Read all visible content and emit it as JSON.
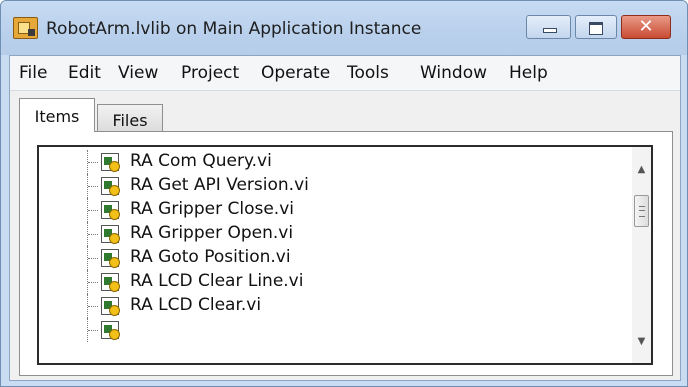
{
  "window": {
    "title": "RobotArm.lvlib on Main Application Instance",
    "icon": "labview-project-icon",
    "controls": {
      "minimize": "minimize-icon",
      "maximize": "maximize-icon",
      "close": "close-icon"
    }
  },
  "menubar": {
    "items": [
      "File",
      "Edit",
      "View",
      "Project",
      "Operate",
      "Tools",
      "Window",
      "Help"
    ]
  },
  "tabs": [
    {
      "label": "Items",
      "active": true
    },
    {
      "label": "Files",
      "active": false
    }
  ],
  "tree": {
    "items": [
      "RA Com Query.vi",
      "RA Get API Version.vi",
      "RA Gripper Close.vi",
      "RA Gripper Open.vi",
      "RA Goto Position.vi",
      "RA LCD Clear Line.vi",
      "RA LCD Clear.vi"
    ],
    "item_icon": "vi-file-icon"
  },
  "scrollbar": {
    "up": "scroll-up-arrow-icon",
    "down": "scroll-down-arrow-icon"
  }
}
